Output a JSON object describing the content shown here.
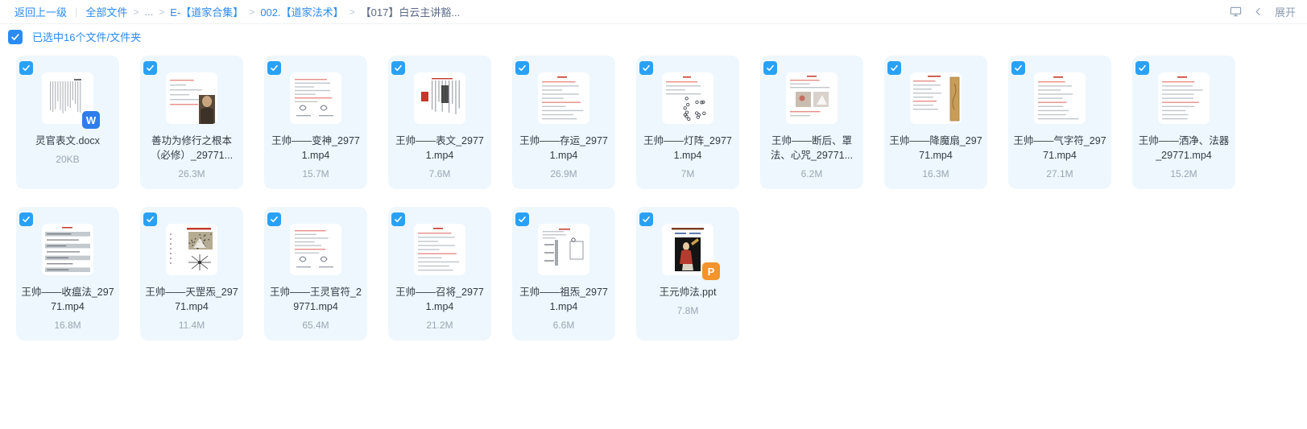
{
  "breadcrumb": {
    "back_label": "返回上一级",
    "divider": "|",
    "root_label": "全部文件",
    "ellipsis": "...",
    "separator": ">",
    "items": [
      {
        "label": "E-【道家合集】",
        "type": "link"
      },
      {
        "label": "002.【道家法术】",
        "type": "link"
      },
      {
        "label": "【017】白云主讲豁...",
        "type": "current"
      }
    ]
  },
  "topbar_right": {
    "display_icon": "monitor-icon",
    "collapse_icon": "chevron-left-icon",
    "expand_label": "展开"
  },
  "selection": {
    "checked": true,
    "label": "已选中16个文件/文件夹",
    "accent": "#2b8bf2"
  },
  "files": [
    {
      "name": "灵官表文.docx",
      "size": "20KB",
      "selected": true,
      "badge": "W",
      "badge_color": "#2f7ded",
      "thumb": "doc-text",
      "lines": 1
    },
    {
      "name": "善功为修行之根本（必修）_29771...",
      "size": "26.3M",
      "selected": true,
      "badge": "",
      "badge_color": "",
      "thumb": "note-portrait",
      "lines": 2
    },
    {
      "name": "王帅——变神_29771.mp4",
      "size": "15.7M",
      "selected": true,
      "badge": "",
      "badge_color": "",
      "thumb": "note-sketch",
      "lines": 2
    },
    {
      "name": "王帅——表文_29771.mp4",
      "size": "7.6M",
      "selected": true,
      "badge": "",
      "badge_color": "",
      "thumb": "scroll-red",
      "lines": 2
    },
    {
      "name": "王帅——存运_29771.mp4",
      "size": "26.9M",
      "selected": true,
      "badge": "",
      "badge_color": "",
      "thumb": "note-lines",
      "lines": 2
    },
    {
      "name": "王帅——灯阵_29771.mp4",
      "size": "7M",
      "selected": true,
      "badge": "",
      "badge_color": "",
      "thumb": "note-dots",
      "lines": 2
    },
    {
      "name": "王帅——断后、罩法、心咒_29771...",
      "size": "6.2M",
      "selected": true,
      "badge": "",
      "badge_color": "",
      "thumb": "note-photos",
      "lines": 2
    },
    {
      "name": "王帅——降魔扇_29771.mp4",
      "size": "16.3M",
      "selected": true,
      "badge": "",
      "badge_color": "",
      "thumb": "note-fan",
      "lines": 2
    },
    {
      "name": "王帅——气字符_29771.mp4",
      "size": "27.1M",
      "selected": true,
      "badge": "",
      "badge_color": "",
      "thumb": "note-lines",
      "lines": 2
    },
    {
      "name": "王帅——洒净、法器_29771.mp4",
      "size": "15.2M",
      "selected": true,
      "badge": "",
      "badge_color": "",
      "thumb": "note-lines",
      "lines": 2
    },
    {
      "name": "王帅——收瘟法_29771.mp4",
      "size": "16.8M",
      "selected": true,
      "badge": "",
      "badge_color": "",
      "thumb": "note-bars",
      "lines": 2
    },
    {
      "name": "王帅——天罡炁_29771.mp4",
      "size": "11.4M",
      "selected": true,
      "badge": "",
      "badge_color": "",
      "thumb": "note-chart",
      "lines": 2
    },
    {
      "name": "王帅——王灵官符_29771.mp4",
      "size": "65.4M",
      "selected": true,
      "badge": "",
      "badge_color": "",
      "thumb": "note-sketch",
      "lines": 2
    },
    {
      "name": "王帅——召将_29771.mp4",
      "size": "21.2M",
      "selected": true,
      "badge": "",
      "badge_color": "",
      "thumb": "note-lines",
      "lines": 2
    },
    {
      "name": "王帅——祖炁_29771.mp4",
      "size": "6.6M",
      "selected": true,
      "badge": "",
      "badge_color": "",
      "thumb": "note-diagram",
      "lines": 2
    },
    {
      "name": "王元帅法.ppt",
      "size": "7.8M",
      "selected": true,
      "badge": "P",
      "badge_color": "#f3942c",
      "thumb": "ppt-cover",
      "lines": 1
    }
  ]
}
